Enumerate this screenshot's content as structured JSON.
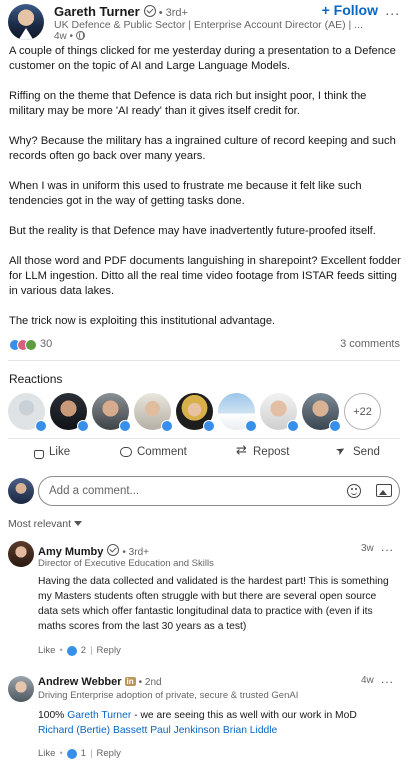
{
  "author": {
    "name": "Gareth Turner",
    "degree": "• 3rd+",
    "headline": "UK Defence & Public Sector | Enterprise Account Director (AE) | ...",
    "time": "4w •",
    "follow_label": "+ Follow",
    "more_label": "..."
  },
  "post": {
    "paragraphs": [
      "A couple of things clicked for me yesterday during a presentation to a Defence customer on the topic of AI and Large Language Models.",
      "Riffing on the theme that Defence is data rich but insight poor, I think the military may be more 'AI ready' than it gives itself credit for.",
      "Why? Because the military has a ingrained culture of record keeping and such records often go back over many years.",
      "When I was in uniform this used to frustrate me because it felt like such tendencies got in the way of getting tasks done.",
      "But the reality is that Defence may have inadvertently future-proofed itself.",
      "All those word and PDF documents languishing in sharepoint? Excellent fodder for LLM ingestion. Ditto all the real time video footage from ISTAR feeds sitting in various data lakes.",
      "The trick now is exploiting this institutional advantage."
    ]
  },
  "social": {
    "reaction_count": "30",
    "comments_count": "3 comments"
  },
  "reactions": {
    "title": "Reactions",
    "more_label": "+22"
  },
  "actions": {
    "like": "Like",
    "comment": "Comment",
    "repost": "Repost",
    "send": "Send"
  },
  "composer": {
    "placeholder": "Add a comment..."
  },
  "sort": {
    "label": "Most relevant"
  },
  "comments": [
    {
      "name": "Amy Mumby",
      "degree": "• 3rd+",
      "headline": "Director of Executive Education and Skills",
      "time": "3w",
      "text": "Having the data collected and validated is the hardest part! This is something my Masters students often struggle with but there are several open source data sets which offer fantastic longitudinal data to practice with (even if its maths scores from the last 30 years as a test)",
      "like_label": "Like",
      "like_count": "2",
      "reply_label": "Reply"
    },
    {
      "name": "Andrew Webber",
      "badge": "in",
      "degree": "• 2nd",
      "headline": "Driving Enterprise adoption of private, secure & trusted GenAI",
      "time": "4w",
      "text_prefix": "100% ",
      "mention1": "Gareth Turner",
      "text_mid": " - we are seeing this as well with our work in MoD ",
      "mention2": "Richard (Bertie) Bassett",
      "mention3": "Paul Jenkinson",
      "mention4": "Brian Liddle",
      "like_label": "Like",
      "like_count": "1",
      "reply_label": "Reply"
    }
  ],
  "colors": {
    "link": "#0a66c2",
    "like_blue": "#378fe9",
    "text": "#191919",
    "muted": "#666666"
  }
}
